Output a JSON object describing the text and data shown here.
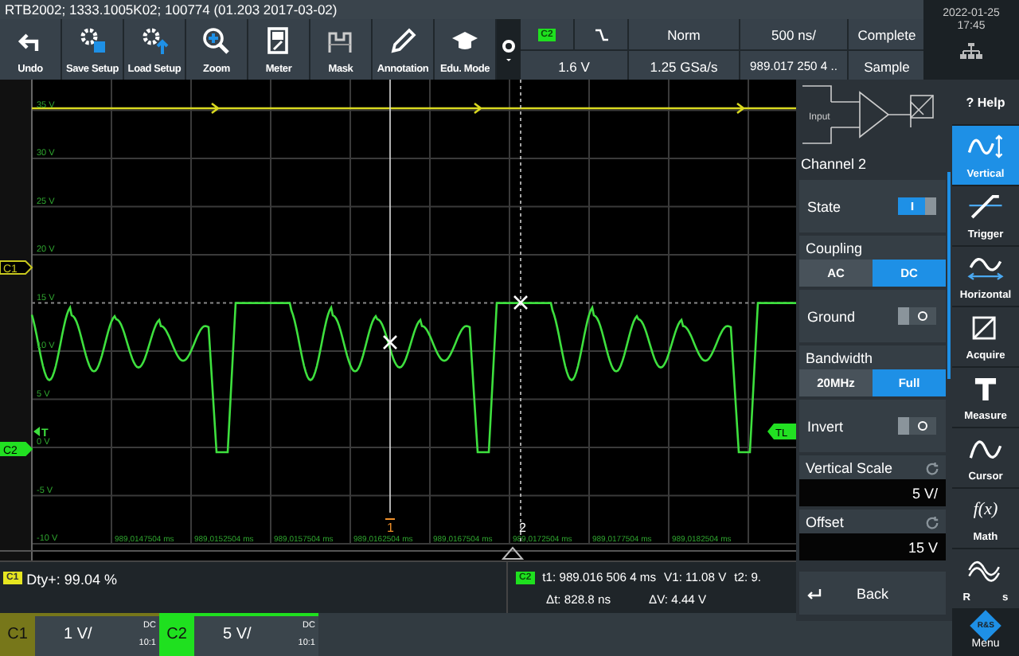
{
  "title_bar": {
    "title": "RTB2002; 1333.1005K02; 100774 (01.203 2017-03-02)"
  },
  "toolbar": {
    "buttons": [
      {
        "label": "Undo"
      },
      {
        "label": "Save Setup"
      },
      {
        "label": "Load Setup"
      },
      {
        "label": "Zoom"
      },
      {
        "label": "Meter"
      },
      {
        "label": "Mask"
      },
      {
        "label": "Annotation"
      },
      {
        "label": "Edu. Mode"
      }
    ]
  },
  "status": {
    "channel_badge": "C2",
    "trigger_level": "1.6 V",
    "trigger_mode": "Norm",
    "sample_rate": "1.25 GSa/s",
    "time_scale": "500 ns/",
    "trigger_time": "989.017 250 4 ..",
    "acquisition": "Complete",
    "mode": "Sample",
    "date": "2022-01-25",
    "time": "17:45"
  },
  "scope": {
    "y_labels": [
      "35 V",
      "30 V",
      "25 V",
      "20 V",
      "15 V",
      "10 V",
      "5 V",
      "0 V",
      "-5 V",
      "-10 V"
    ],
    "x_labels": [
      "989,0147504 ms",
      "989,0152504 ms",
      "989,0157504 ms",
      "989,0162504 ms",
      "989,0167504 ms",
      "989,0172504 ms",
      "989,0177504 ms",
      "989,0182504 ms"
    ],
    "markers": [
      {
        "label": "C1",
        "color": "#c8c81e"
      },
      {
        "label": "C2",
        "color": "#22e022"
      }
    ],
    "trigger_label": "T",
    "trigger_level_tag": "TL",
    "cursor_labels": [
      "1",
      "2"
    ]
  },
  "measurement": {
    "channel": "C1",
    "text": "Dty+: 99.04 %"
  },
  "cursor_readout": {
    "channel": "C2",
    "t1": "t1: 989.016 506 4 ms",
    "v1": "V1: 11.08 V",
    "t2": "t2: 9.",
    "dt": "Δt: 828.8 ns",
    "dv": "ΔV: 4.44 V"
  },
  "channels": [
    {
      "label": "C1",
      "scale": "1 V/",
      "coupling": "DC",
      "probe": "10:1",
      "color": "#77771a"
    },
    {
      "label": "C2",
      "scale": "5 V/",
      "coupling": "DC",
      "probe": "10:1",
      "color": "#1fe01f"
    }
  ],
  "panel": {
    "diagram_label": "Input",
    "title": "Channel 2",
    "rows": [
      {
        "kind": "toggle",
        "label": "State",
        "on": true
      },
      {
        "kind": "choice",
        "label": "Coupling",
        "options": [
          {
            "label": "AC",
            "selected": false
          },
          {
            "label": "DC",
            "selected": true
          }
        ]
      },
      {
        "kind": "toggle",
        "label": "Ground",
        "on": false
      },
      {
        "kind": "choice",
        "label": "Bandwidth",
        "options": [
          {
            "label": "20MHz",
            "selected": false
          },
          {
            "label": "Full",
            "selected": true
          }
        ]
      },
      {
        "kind": "toggle",
        "label": "Invert",
        "on": false
      },
      {
        "kind": "value",
        "label": "Vertical Scale",
        "value": "5 V/"
      },
      {
        "kind": "value",
        "label": "Offset",
        "value": "15 V"
      }
    ],
    "back": "Back"
  },
  "nav": {
    "help": "? Help",
    "items": [
      {
        "label": "Vertical",
        "selected": true
      },
      {
        "label": "Trigger",
        "selected": false
      },
      {
        "label": "Horizontal",
        "selected": false
      },
      {
        "label": "Acquire",
        "selected": false
      },
      {
        "label": "Measure",
        "selected": false
      },
      {
        "label": "Cursor",
        "selected": false
      },
      {
        "label": "Math",
        "glyph": "f(x)",
        "selected": false
      },
      {
        "label": "R",
        "label_tail": "s",
        "selected": false
      }
    ],
    "logo": "R&S",
    "menu": "Menu"
  }
}
